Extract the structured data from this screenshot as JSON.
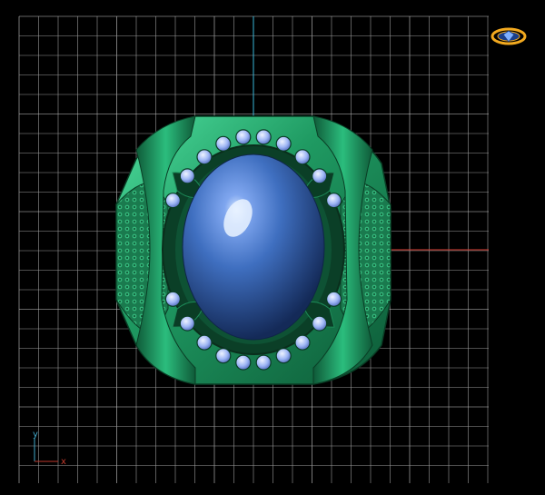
{
  "viewport": {
    "view": "Top",
    "background": "#000000",
    "grid_color": "#9a9a9a",
    "grid_major_color": "#c8c8c8"
  },
  "axes_gizmo": {
    "x_label": "x",
    "y_label": "y",
    "x_color": "#c0392b",
    "y_color": "#3fa7c9"
  },
  "axis_lines": {
    "x_color": "#d63a2f",
    "y_color": "#37b6d9"
  },
  "view_cube": {
    "icon": "ring-view-cube-icon",
    "color": "#f2a91f"
  },
  "model": {
    "name": "ring-model",
    "metal_color": "#1f8a5a",
    "metal_highlight": "#3cc98b",
    "stone_color": "#2f5fa8",
    "stone_highlight": "#8fb9ff",
    "accent_stone_color": "#9fb8ff",
    "top_accent_count": 10,
    "bottom_accent_count": 10
  }
}
